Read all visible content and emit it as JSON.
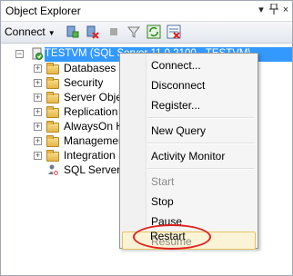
{
  "window": {
    "title": "Object Explorer",
    "pin_glyph": "↓",
    "autohide_glyph": "⌂",
    "close_glyph": "×"
  },
  "toolbar": {
    "connect_label": "Connect",
    "connect_arrow": "▼",
    "icons": [
      "connect-server-icon",
      "disconnect-icon",
      "stop-icon",
      "filter-icon",
      "refresh-icon",
      "restart-server-icon"
    ]
  },
  "tree": {
    "root_label": "TESTVM (SQL Server 11.0.2100 - TESTVM\\",
    "items": [
      {
        "label": "Databases"
      },
      {
        "label": "Security"
      },
      {
        "label": "Server Objects"
      },
      {
        "label": "Replication"
      },
      {
        "label": "AlwaysOn High Availability"
      },
      {
        "label": "Management"
      },
      {
        "label": "Integration Services Catalogs"
      },
      {
        "label": "SQL Server Agent (Agent XPs disabled)"
      }
    ]
  },
  "context_menu": {
    "items": [
      {
        "label": "Connect...",
        "enabled": true
      },
      {
        "label": "Disconnect",
        "enabled": true
      },
      {
        "label": "Register...",
        "enabled": true
      },
      {
        "label": "New Query",
        "enabled": true
      },
      {
        "label": "Activity Monitor",
        "enabled": true
      },
      {
        "label": "Start",
        "enabled": false
      },
      {
        "label": "Stop",
        "enabled": true
      },
      {
        "label": "Pause",
        "enabled": true
      },
      {
        "label": "Resume",
        "enabled": false
      },
      {
        "label": "Restart",
        "enabled": true
      }
    ],
    "highlighted": "Resume",
    "annotated": "Restart"
  },
  "colors": {
    "selection": "#3399ff",
    "menu_hover_border": "#e5c365",
    "annotation": "#e02020"
  }
}
